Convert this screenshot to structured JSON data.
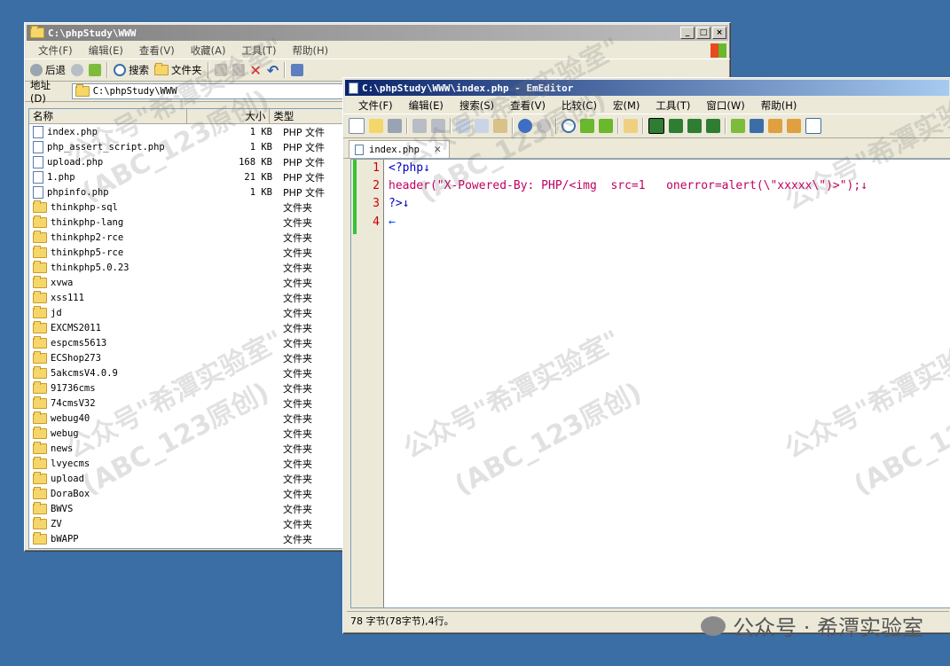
{
  "explorer": {
    "title": "C:\\phpStudy\\WWW",
    "menu": [
      "文件(F)",
      "编辑(E)",
      "查看(V)",
      "收藏(A)",
      "工具(T)",
      "帮助(H)"
    ],
    "toolbar": {
      "back": "后退",
      "search": "搜索",
      "folders": "文件夹"
    },
    "address_label": "地址(D)",
    "address_value": "C:\\phpStudy\\WWW",
    "columns": {
      "name": "名称",
      "size": "大小",
      "type": "类型"
    },
    "files": [
      {
        "name": "index.php",
        "size": "1 KB",
        "type": "PHP 文件",
        "kind": "file"
      },
      {
        "name": "php_assert_script.php",
        "size": "1 KB",
        "type": "PHP 文件",
        "kind": "file"
      },
      {
        "name": "upload.php",
        "size": "168 KB",
        "type": "PHP 文件",
        "kind": "file"
      },
      {
        "name": "1.php",
        "size": "21 KB",
        "type": "PHP 文件",
        "kind": "file"
      },
      {
        "name": "phpinfo.php",
        "size": "1 KB",
        "type": "PHP 文件",
        "kind": "file"
      },
      {
        "name": "thinkphp-sql",
        "size": "",
        "type": "文件夹",
        "kind": "folder"
      },
      {
        "name": "thinkphp-lang",
        "size": "",
        "type": "文件夹",
        "kind": "folder"
      },
      {
        "name": "thinkphp2-rce",
        "size": "",
        "type": "文件夹",
        "kind": "folder"
      },
      {
        "name": "thinkphp5-rce",
        "size": "",
        "type": "文件夹",
        "kind": "folder"
      },
      {
        "name": "thinkphp5.0.23",
        "size": "",
        "type": "文件夹",
        "kind": "folder"
      },
      {
        "name": "xvwa",
        "size": "",
        "type": "文件夹",
        "kind": "folder"
      },
      {
        "name": "xss111",
        "size": "",
        "type": "文件夹",
        "kind": "folder"
      },
      {
        "name": "jd",
        "size": "",
        "type": "文件夹",
        "kind": "folder"
      },
      {
        "name": "EXCMS2011",
        "size": "",
        "type": "文件夹",
        "kind": "folder"
      },
      {
        "name": "espcms5613",
        "size": "",
        "type": "文件夹",
        "kind": "folder"
      },
      {
        "name": "ECShop273",
        "size": "",
        "type": "文件夹",
        "kind": "folder"
      },
      {
        "name": "5akcmsV4.0.9",
        "size": "",
        "type": "文件夹",
        "kind": "folder"
      },
      {
        "name": "91736cms",
        "size": "",
        "type": "文件夹",
        "kind": "folder"
      },
      {
        "name": "74cmsV32",
        "size": "",
        "type": "文件夹",
        "kind": "folder"
      },
      {
        "name": "webug40",
        "size": "",
        "type": "文件夹",
        "kind": "folder"
      },
      {
        "name": "webug",
        "size": "",
        "type": "文件夹",
        "kind": "folder"
      },
      {
        "name": "news",
        "size": "",
        "type": "文件夹",
        "kind": "folder"
      },
      {
        "name": "lvyecms",
        "size": "",
        "type": "文件夹",
        "kind": "folder"
      },
      {
        "name": "upload",
        "size": "",
        "type": "文件夹",
        "kind": "folder"
      },
      {
        "name": "DoraBox",
        "size": "",
        "type": "文件夹",
        "kind": "folder"
      },
      {
        "name": "BWVS",
        "size": "",
        "type": "文件夹",
        "kind": "folder"
      },
      {
        "name": "ZV",
        "size": "",
        "type": "文件夹",
        "kind": "folder"
      },
      {
        "name": "bWAPP",
        "size": "",
        "type": "文件夹",
        "kind": "folder"
      }
    ]
  },
  "editor": {
    "title": "C:\\phpStudy\\WWW\\index.php - EmEditor",
    "menu": [
      "文件(F)",
      "编辑(E)",
      "搜索(S)",
      "查看(V)",
      "比较(C)",
      "宏(M)",
      "工具(T)",
      "窗口(W)",
      "帮助(H)"
    ],
    "tab_label": "index.php",
    "lines": [
      {
        "num": "1",
        "text": "<?php↓"
      },
      {
        "num": "2",
        "text": "header(\"X-Powered-By: PHP/<img  src=1   onerror=alert(\\\"xxxxx\\\")>\");↓"
      },
      {
        "num": "3",
        "text": "?>↓"
      },
      {
        "num": "4",
        "text": "←"
      }
    ],
    "status": "78 字节(78字节),4行。"
  },
  "watermark": {
    "line1": "公众号\"希潭实验室\"",
    "line2": "(ABC_123原创)",
    "brand": "公众号 · 希潭实验室"
  }
}
